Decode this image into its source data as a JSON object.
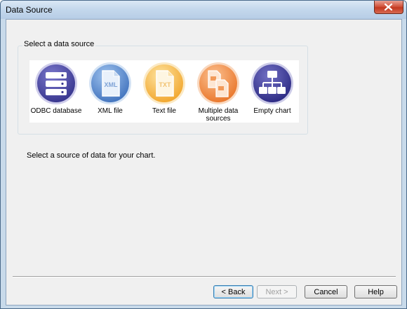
{
  "window": {
    "title": "Data Source"
  },
  "group": {
    "label": "Select a data source"
  },
  "sources": [
    {
      "id": "odbc",
      "label": "ODBC database",
      "icon": "database-icon",
      "color": "#4d4aa6"
    },
    {
      "id": "xml",
      "label": "XML file",
      "icon": "xml-file-icon",
      "color": "#4f84c8",
      "badge": "XML"
    },
    {
      "id": "text",
      "label": "Text file",
      "icon": "text-file-icon",
      "color": "#f4b94a",
      "badge": "TXT"
    },
    {
      "id": "multiple",
      "label": "Multiple data sources",
      "icon": "multiple-files-icon",
      "color": "#f08a43"
    },
    {
      "id": "empty",
      "label": "Empty chart",
      "icon": "org-chart-icon",
      "color": "#3e3c98"
    }
  ],
  "description": "Select a source of data for your chart.",
  "buttons": {
    "back": "< Back",
    "next": "Next >",
    "cancel": "Cancel",
    "help": "Help"
  }
}
